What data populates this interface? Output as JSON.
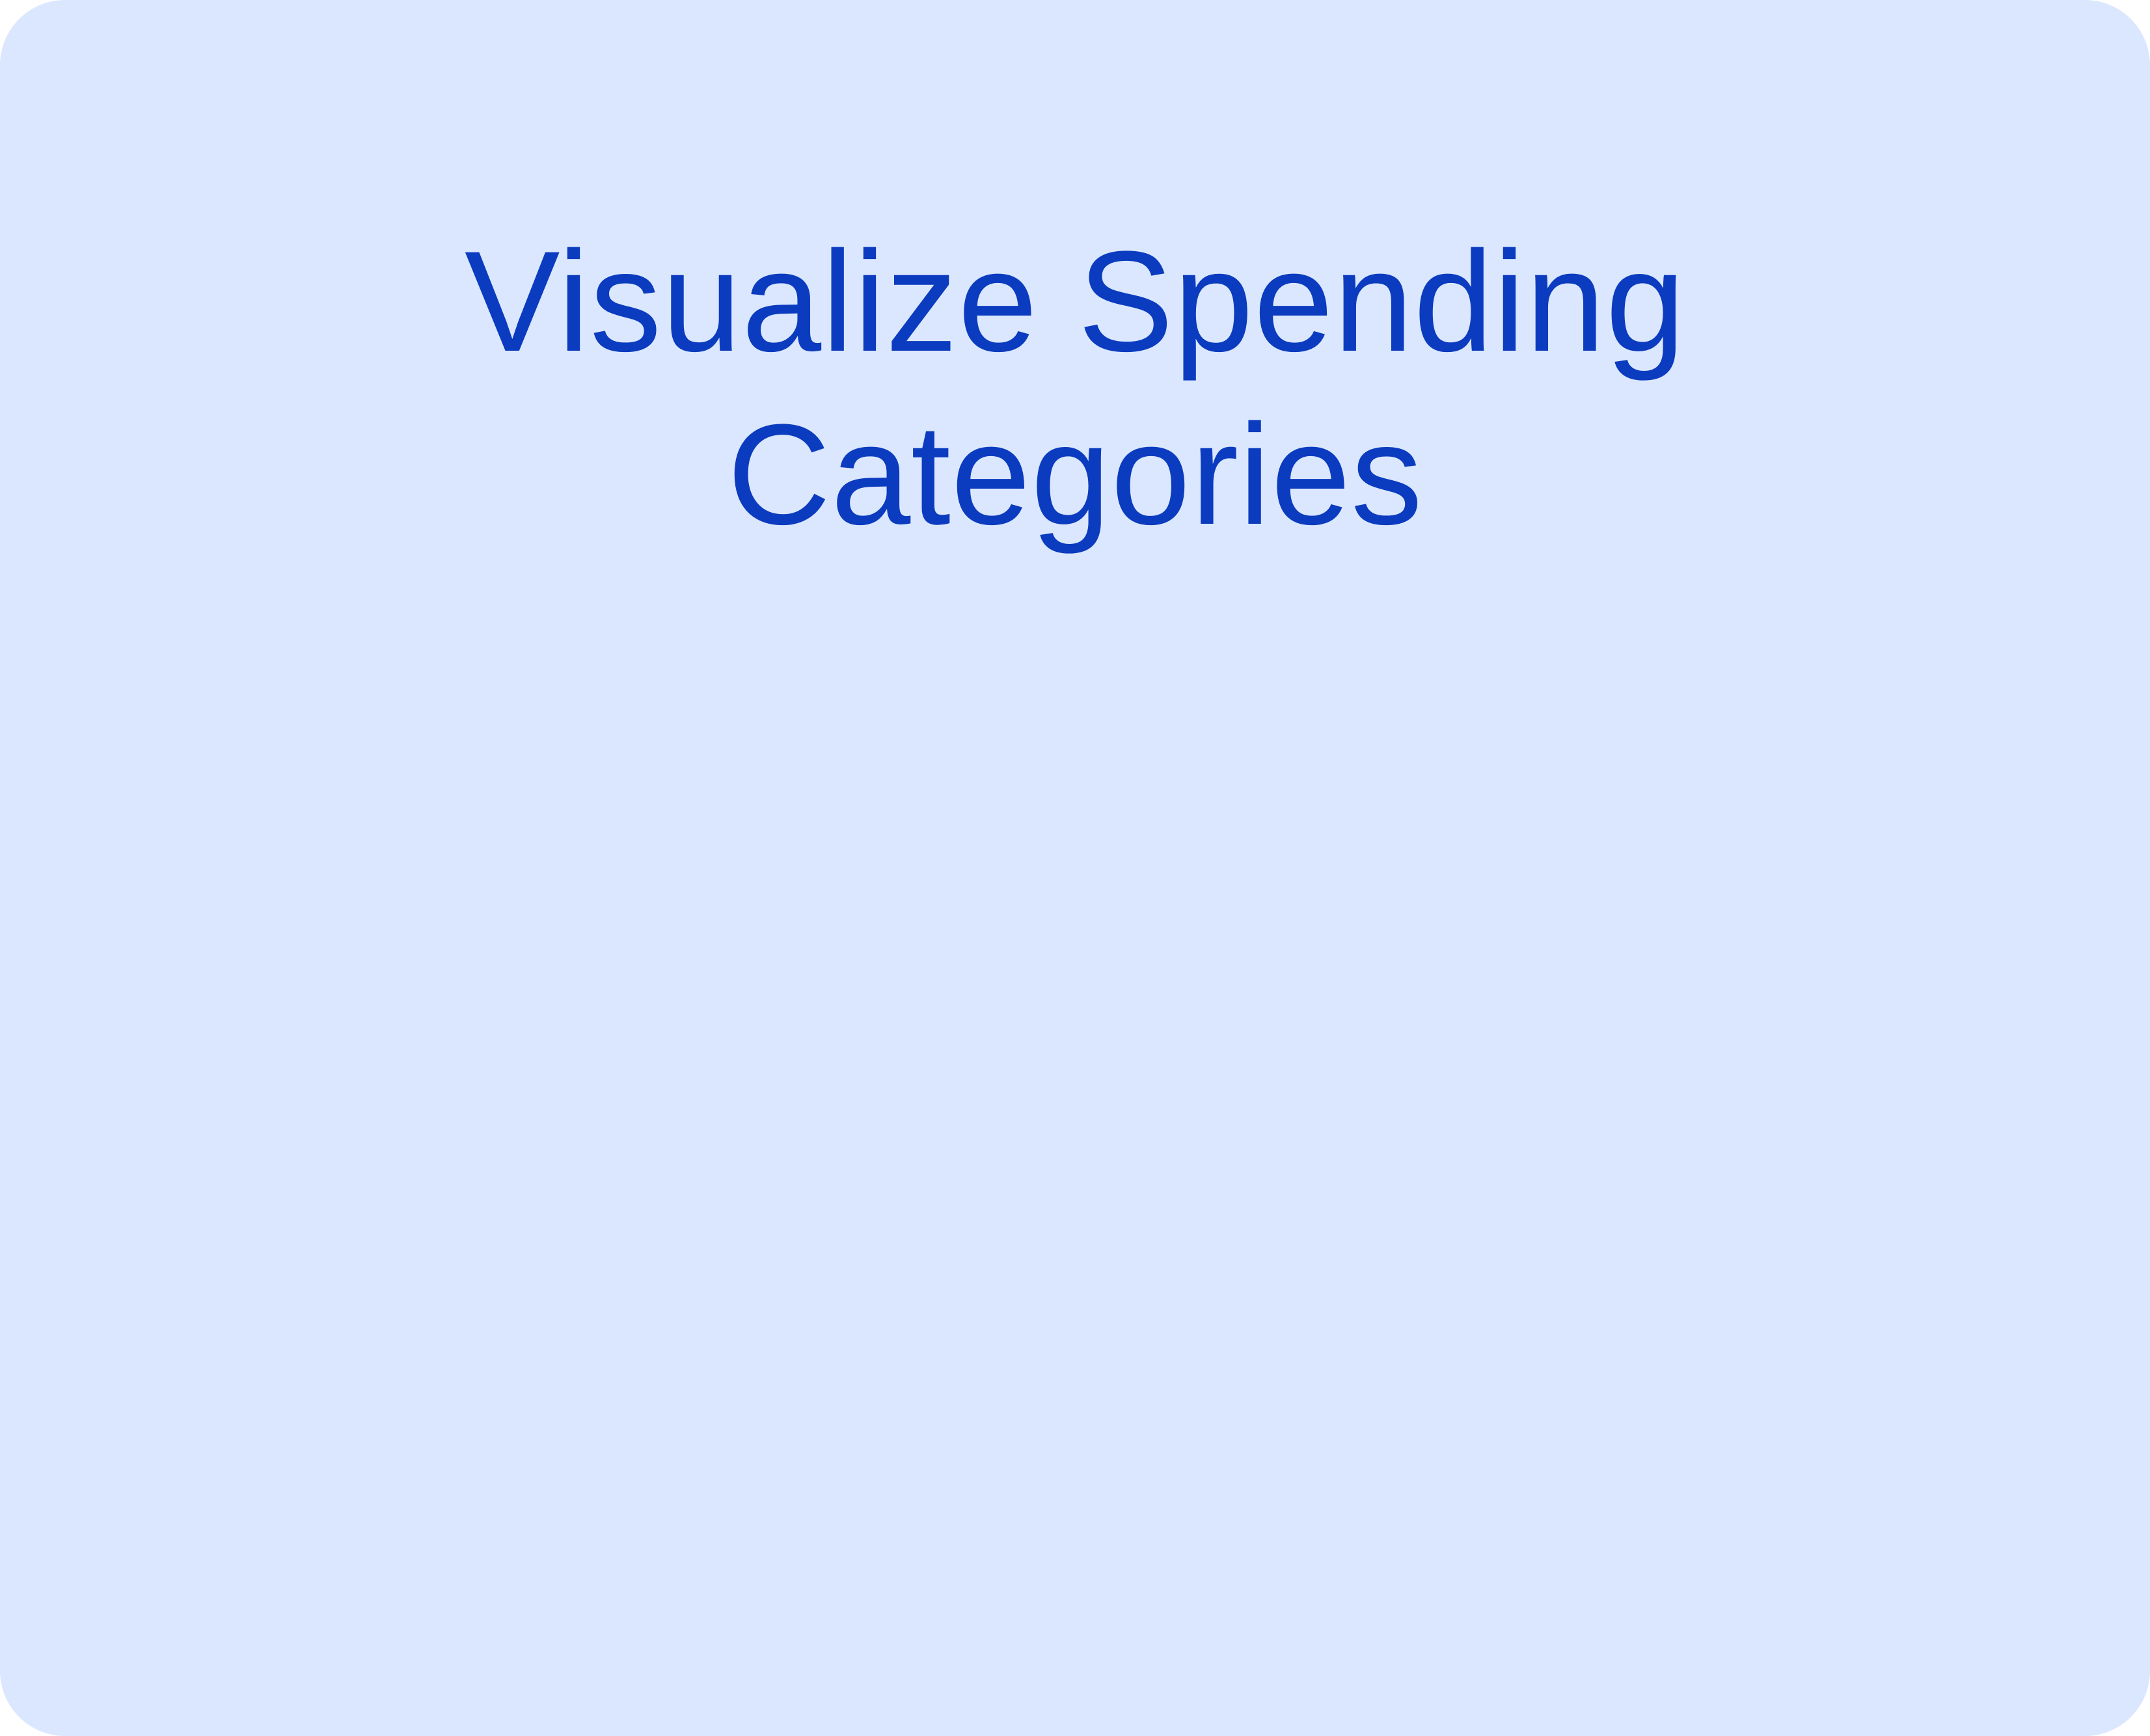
{
  "card": {
    "title": "Visualize Spending Categories"
  },
  "colors": {
    "background": "#dbe7fe",
    "accent": "#0b3bbf"
  }
}
